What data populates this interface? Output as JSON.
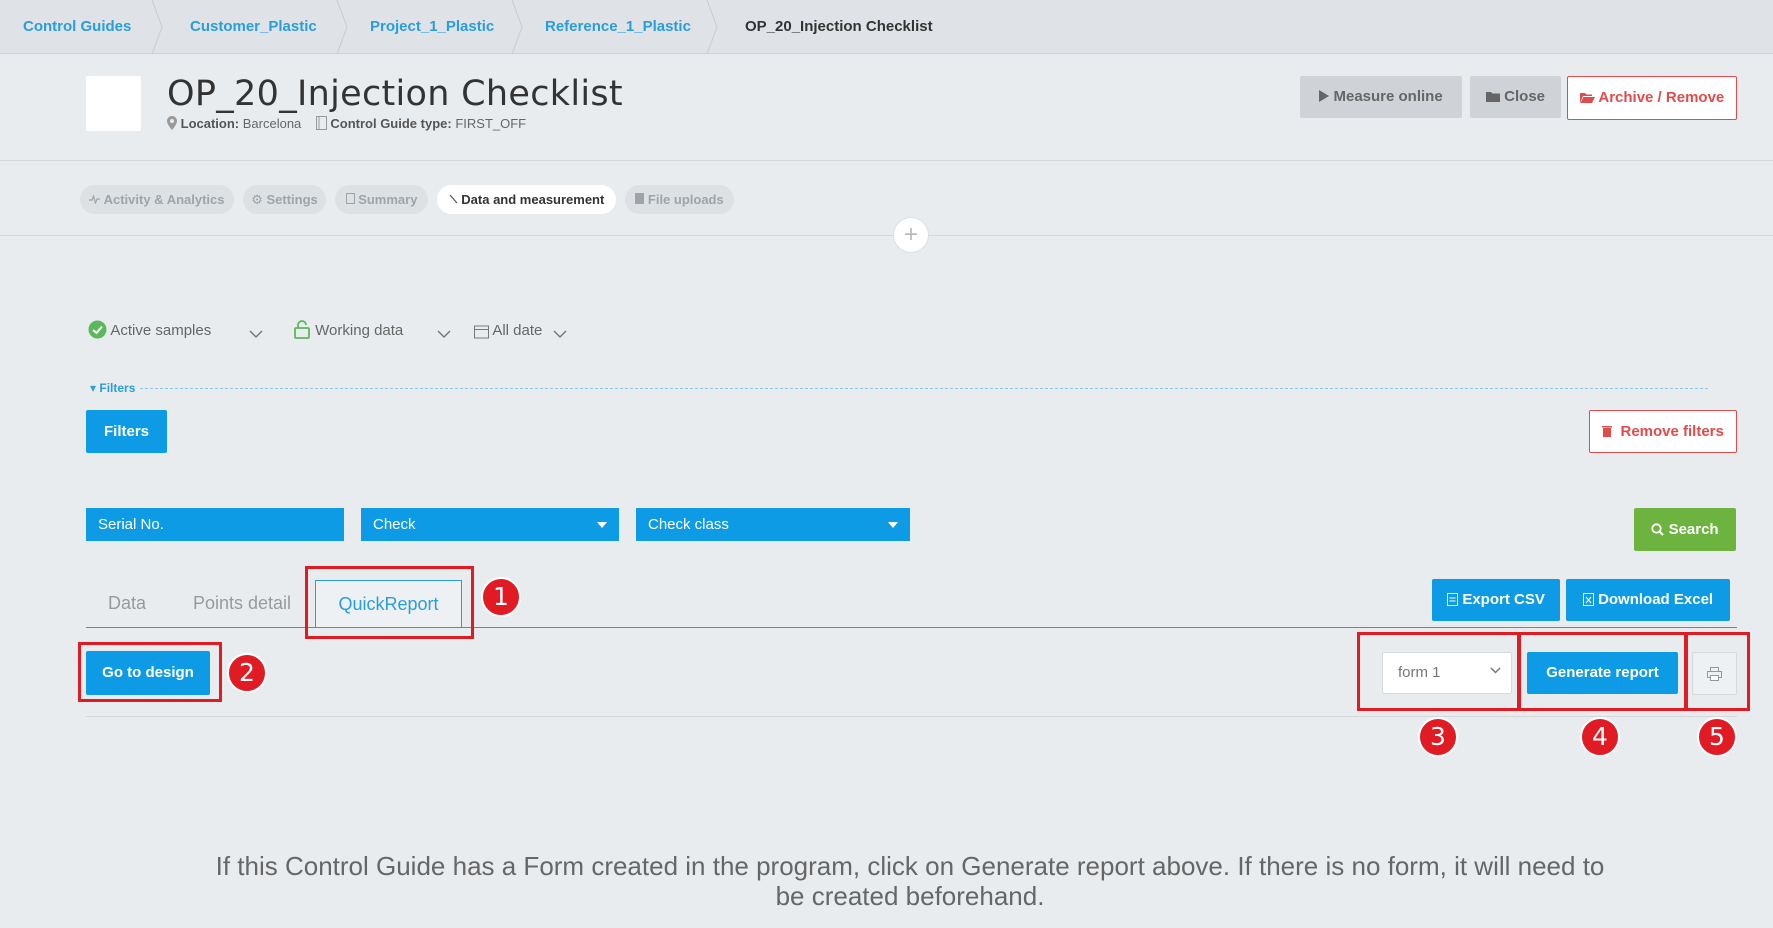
{
  "breadcrumb": [
    "Control Guides",
    "Customer_Plastic",
    "Project_1_Plastic",
    "Reference_1_Plastic",
    "OP_20_Injection Checklist"
  ],
  "header": {
    "title": "OP_20_Injection Checklist",
    "location_label": "Location:",
    "location_value": "Barcelona",
    "type_label": "Control Guide type:",
    "type_value": "FIRST_OFF",
    "measure_online": "Measure online",
    "close": "Close",
    "archive": "Archive / Remove"
  },
  "tabs": {
    "activity": "Activity & Analytics",
    "settings": "Settings",
    "summary": "Summary",
    "data": "Data and measurement",
    "files": "File uploads"
  },
  "selectors": {
    "samples": "Active samples",
    "working": "Working data",
    "date": "All date"
  },
  "filters": {
    "legend": "Filters",
    "button": "Filters",
    "remove": "Remove filters",
    "serial": "Serial No.",
    "check": "Check",
    "check_class": "Check class",
    "search": "Search"
  },
  "data_tabs": [
    "Data",
    "Points detail",
    "QuickReport"
  ],
  "actions": {
    "export_csv": "Export CSV",
    "download_excel": "Download Excel",
    "go_to_design": "Go to design",
    "form_value": "form 1",
    "generate": "Generate report"
  },
  "badges": [
    "1",
    "2",
    "3",
    "4",
    "5"
  ],
  "colors": {
    "accent": "#0e9be6",
    "danger": "#e04b4b",
    "success": "#6cb33f",
    "annotation": "#e01b24"
  },
  "info": "If this Control Guide has a Form created in the program, click on Generate report above. If there is no form, it will need to be created beforehand."
}
